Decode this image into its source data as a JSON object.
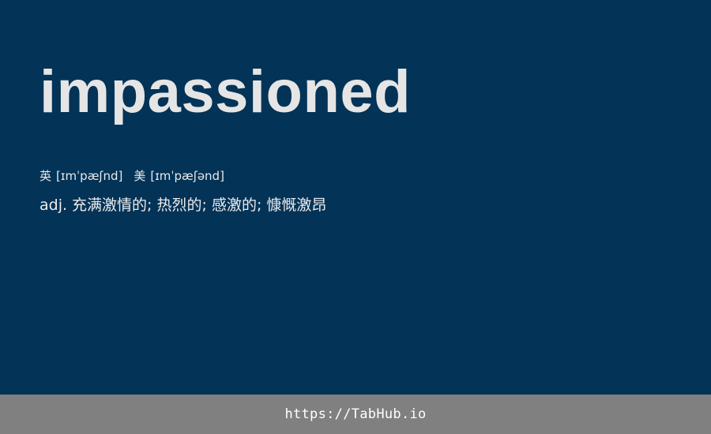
{
  "word": "impassioned",
  "phonetics": {
    "uk_label": "英",
    "uk": "[ɪmˈpæʃnd]",
    "us_label": "美",
    "us": "[ɪmˈpæʃənd]"
  },
  "definition": "adj. 充满激情的; 热烈的; 感激的; 慷慨激昂",
  "footer": {
    "link": "https://TabHub.io"
  },
  "colors": {
    "background": "#033357",
    "footer": "#808080",
    "text": "#e5e5e5"
  }
}
